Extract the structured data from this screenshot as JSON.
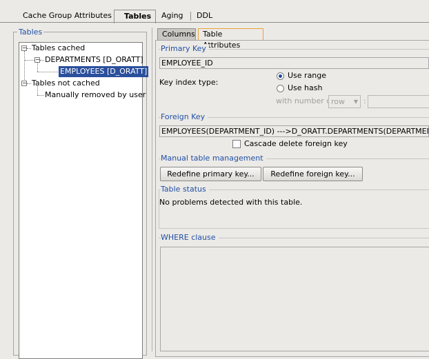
{
  "top_tabs": [
    {
      "label": "Cache Group Attributes",
      "active": false
    },
    {
      "label": "Tables",
      "active": true
    },
    {
      "label": "Aging",
      "active": false
    },
    {
      "label": "DDL",
      "active": false
    }
  ],
  "left": {
    "group_title": "Tables",
    "tree": {
      "cached_label": "Tables cached",
      "departments_label": "DEPARTMENTS [D_ORATT]",
      "employees_label": "EMPLOYEES [D_ORATT]",
      "not_cached_label": "Tables not cached",
      "removed_label": "Manually removed by user"
    }
  },
  "sub_tabs": [
    {
      "label": "Columns",
      "active": false
    },
    {
      "label": "Table Attributes",
      "active": true
    }
  ],
  "primary_key": {
    "title": "Primary Key",
    "value": "EMPLOYEE_ID",
    "key_index_label": "Key index type:",
    "use_range": "Use range",
    "use_hash": "Use hash",
    "selected": "Use range",
    "with_number_label": "with number of",
    "row_option": "row",
    "colon": ":"
  },
  "foreign_key": {
    "title": "Foreign Key",
    "value": "EMPLOYEES(DEPARTMENT_ID) --->D_ORATT.DEPARTMENTS(DEPARTMENT_ID)",
    "cascade_label": "Cascade delete foreign key"
  },
  "manual": {
    "title": "Manual table management",
    "redefine_primary": "Redefine primary key...",
    "redefine_foreign": "Redefine foreign key..."
  },
  "status": {
    "title": "Table status",
    "message": "No problems detected with this table."
  },
  "where": {
    "title": "WHERE clause"
  }
}
